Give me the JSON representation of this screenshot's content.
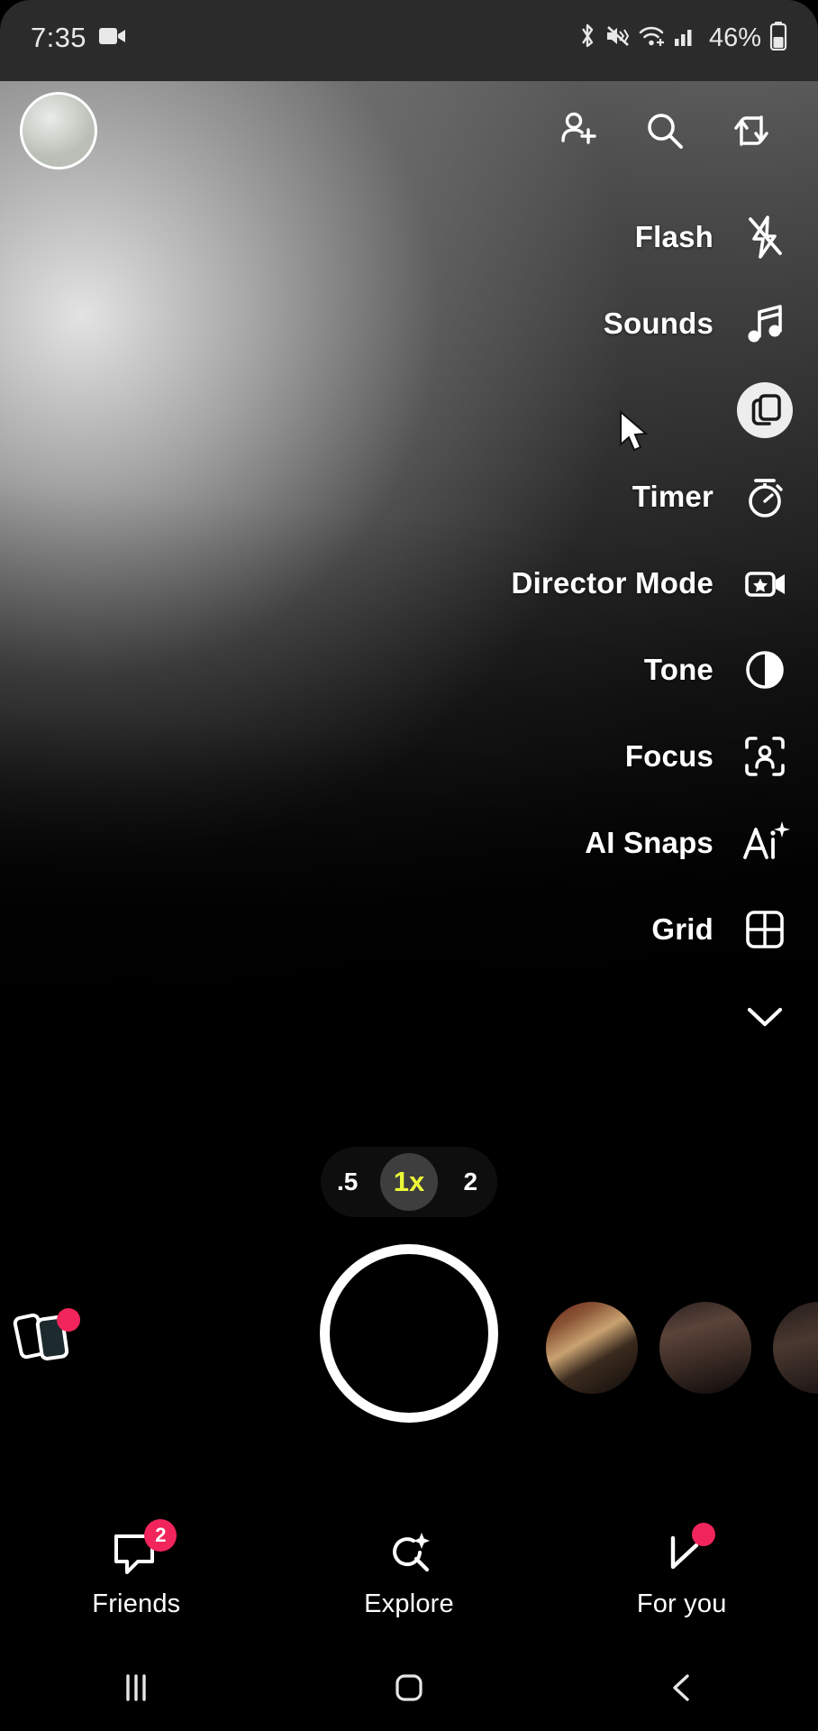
{
  "status_bar": {
    "time": "7:35",
    "recording_icon": "video-camera-icon",
    "bluetooth_icon": "bluetooth-icon",
    "sound_icon": "volume-vibrate-icon",
    "wifi_icon": "wifi-icon",
    "cellular_icon": "cellular-signal-icon",
    "battery_percent": "46%",
    "battery_icon": "battery-icon"
  },
  "top_bar": {
    "avatar": "profile-avatar",
    "icons": [
      {
        "name": "add-friend-icon",
        "label": "Add Friend"
      },
      {
        "name": "search-icon",
        "label": "Search"
      },
      {
        "name": "flip-camera-icon",
        "label": "Flip Camera"
      }
    ]
  },
  "camera_options": [
    {
      "label": "Flash",
      "icon": "flash-off-icon",
      "highlighted": false
    },
    {
      "label": "Sounds",
      "icon": "music-note-icon",
      "highlighted": false
    },
    {
      "label": "",
      "icon": "multi-snap-icon",
      "highlighted": true
    },
    {
      "label": "Timer",
      "icon": "stopwatch-icon",
      "highlighted": false
    },
    {
      "label": "Director Mode",
      "icon": "director-mode-icon",
      "highlighted": false
    },
    {
      "label": "Tone",
      "icon": "tone-contrast-icon",
      "highlighted": false
    },
    {
      "label": "Focus",
      "icon": "focus-face-icon",
      "highlighted": false
    },
    {
      "label": "AI Snaps",
      "icon": "ai-sparkle-icon",
      "highlighted": false
    },
    {
      "label": "Grid",
      "icon": "grid-icon",
      "highlighted": false
    }
  ],
  "collapse_button": {
    "name": "chevron-down-icon",
    "label": "Collapse options"
  },
  "zoom_selector": {
    "options": [
      {
        "value": ".5",
        "selected": false
      },
      {
        "value": "1x",
        "selected": true
      },
      {
        "value": "2",
        "selected": false
      }
    ],
    "selected_color": "#ecf738"
  },
  "capture": {
    "shutter_label": "Capture",
    "memories_icon": "memories-icon",
    "memories_has_badge": true,
    "story_thumbs": [
      "story-thumbnail-1",
      "story-thumbnail-2",
      "story-thumbnail-3"
    ]
  },
  "bottom_nav": [
    {
      "label": "Friends",
      "icon": "chat-bubble-icon",
      "badge": "2",
      "dot": false
    },
    {
      "label": "Explore",
      "icon": "explore-star-search-icon",
      "badge": "",
      "dot": false
    },
    {
      "label": "For you",
      "icon": "spotlight-play-icon",
      "badge": "",
      "dot": true
    }
  ],
  "system_nav": [
    {
      "name": "recents-button",
      "label": "Recents"
    },
    {
      "name": "home-button",
      "label": "Home"
    },
    {
      "name": "back-button",
      "label": "Back"
    }
  ],
  "colors": {
    "accent_yellow": "#ecf738",
    "badge_red": "#f2245c",
    "text_white": "#ffffff"
  }
}
